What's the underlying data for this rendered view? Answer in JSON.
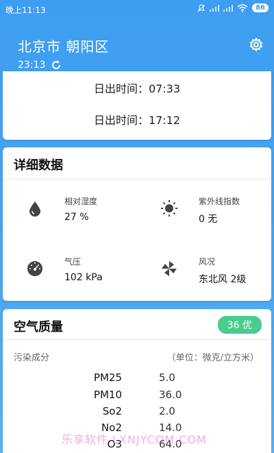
{
  "statusbar": {
    "time": "晚上11:13",
    "battery": "86"
  },
  "header": {
    "city": "北京市  朝阳区",
    "updated_time": "23:13"
  },
  "sun": {
    "sunrise_text": "日出时间：07:33",
    "sunset_text": "日出时间：17:12"
  },
  "detail": {
    "title": "详细数据",
    "humidity_label": "相对湿度",
    "humidity_value": "27 %",
    "uv_label": "紫外线指数",
    "uv_value": "0  无",
    "pressure_label": "气压",
    "pressure_value": "102 kPa",
    "wind_label": "风况",
    "wind_value": "东北风 2级"
  },
  "air": {
    "title": "空气质量",
    "aqi_badge": "36 优",
    "pollutant_header": "污染成分",
    "unit_header": "（单位：微克/立方米）",
    "pollutants": [
      {
        "name": "PM25",
        "value": "5.0"
      },
      {
        "name": "PM10",
        "value": "36.0"
      },
      {
        "name": "So2",
        "value": "2.0"
      },
      {
        "name": "No2",
        "value": "14.0"
      },
      {
        "name": "O3",
        "value": "64.0"
      }
    ]
  },
  "watermark": "乐享软件 LXNJYCOM.COM",
  "colors": {
    "sky_blue": "#3d9df0",
    "aqi_green": "#4ccb8f"
  },
  "icons": [
    "bell-off-icon",
    "signal-icon",
    "wifi-icon",
    "refresh-icon",
    "gear-icon",
    "drop-icon",
    "sun-icon",
    "gauge-icon",
    "pinwheel-icon"
  ]
}
